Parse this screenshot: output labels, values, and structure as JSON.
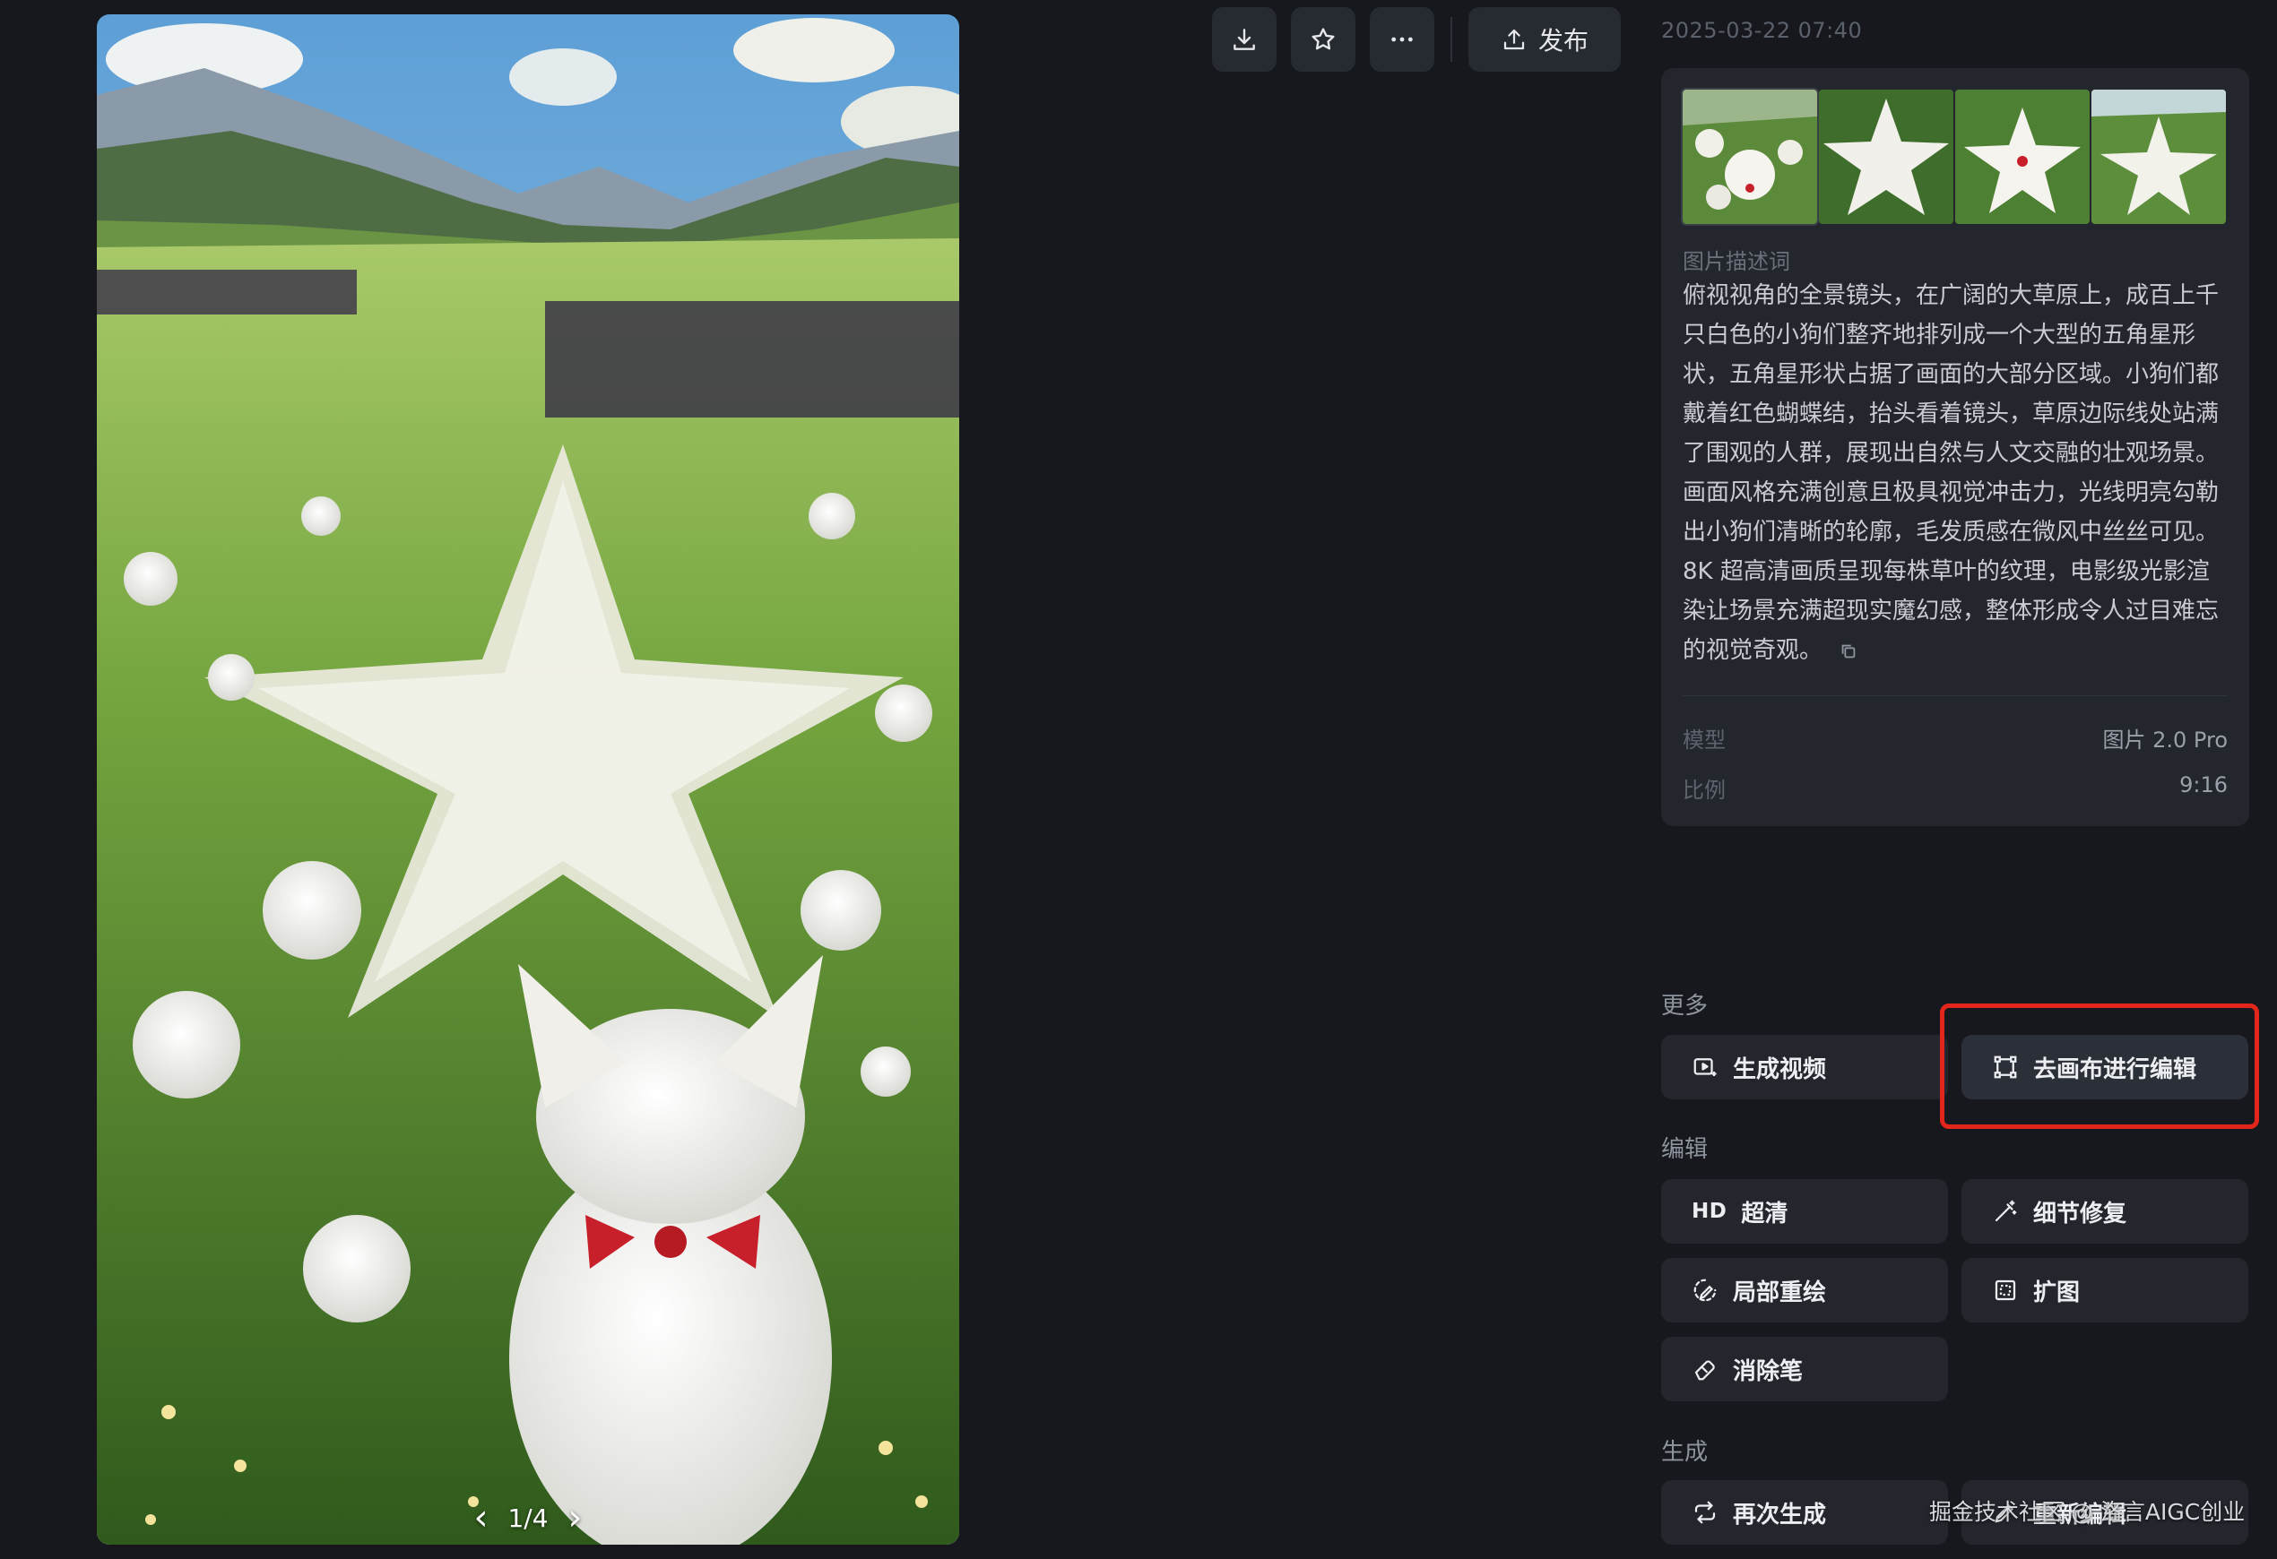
{
  "toolbar": {
    "download_icon": "download-icon",
    "favorite_icon": "star-icon",
    "more_icon": "more-dots-icon",
    "publish_label": "发布",
    "publish_icon": "upload-icon"
  },
  "image": {
    "pager": "1/4"
  },
  "info": {
    "timestamp": "2025-03-22 07:40",
    "thumbnail_count": 4,
    "description_label": "图片描述词",
    "description": "俯视视角的全景镜头，在广阔的大草原上，成百上千只白色的小狗们整齐地排列成一个大型的五角星形状，五角星形状占据了画面的大部分区域。小狗们都戴着红色蝴蝶结，抬头看着镜头，草原边际线处站满了围观的人群，展现出自然与人文交融的壮观场景。画面风格充满创意且极具视觉冲击力，光线明亮勾勒出小狗们清晰的轮廓，毛发质感在微风中丝丝可见。8K 超高清画质呈现每株草叶的纹理，电影级光影渲染让场景充满超现实魔幻感，整体形成令人过目难忘的视觉奇观。",
    "model_label": "模型",
    "model_value": "图片 2.0 Pro",
    "ratio_label": "比例",
    "ratio_value": "9:16"
  },
  "sections": {
    "more": {
      "title": "更多",
      "generate_video": "生成视频",
      "canvas_edit": "去画布进行编辑"
    },
    "edit": {
      "title": "编辑",
      "hd_tag": "HD",
      "upscale": "超清",
      "detail_fix": "细节修复",
      "inpaint": "局部重绘",
      "outpaint": "扩图",
      "eraser": "消除笔"
    },
    "generate": {
      "title": "生成",
      "regenerate": "再次生成",
      "re_edit": "重新编辑"
    }
  },
  "watermark": "掘金技术社区 @ 洛言AIGC创业",
  "colors": {
    "background": "#16181d",
    "card": "#23262d",
    "highlight": "#e3261c"
  }
}
